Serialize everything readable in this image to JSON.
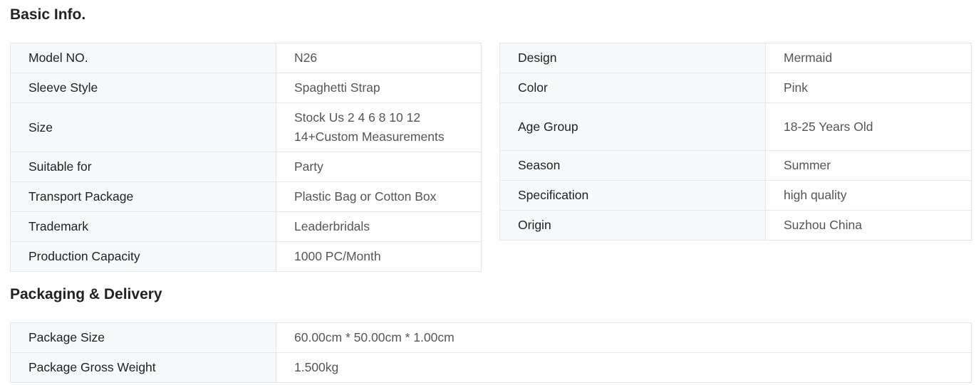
{
  "basic": {
    "title": "Basic Info.",
    "left": [
      {
        "key": "Model NO.",
        "value": "N26"
      },
      {
        "key": "Sleeve Style",
        "value": "Spaghetti Strap"
      },
      {
        "key": "Size",
        "value": "Stock Us 2 4 6 8 10 12 14+Custom Measurements"
      },
      {
        "key": "Suitable for",
        "value": "Party"
      },
      {
        "key": "Transport Package",
        "value": "Plastic Bag or Cotton Box"
      },
      {
        "key": "Trademark",
        "value": "Leaderbridals"
      },
      {
        "key": "Production Capacity",
        "value": "1000 PC/Month"
      }
    ],
    "right": [
      {
        "key": "Design",
        "value": "Mermaid"
      },
      {
        "key": "Color",
        "value": "Pink"
      },
      {
        "key": "Age Group",
        "value": "18-25 Years Old"
      },
      {
        "key": "Season",
        "value": "Summer"
      },
      {
        "key": "Specification",
        "value": "high quality"
      },
      {
        "key": "Origin",
        "value": "Suzhou China"
      }
    ]
  },
  "packaging": {
    "title": "Packaging & Delivery",
    "rows": [
      {
        "key": "Package Size",
        "value": "60.00cm * 50.00cm * 1.00cm"
      },
      {
        "key": "Package Gross Weight",
        "value": "1.500kg"
      }
    ]
  }
}
